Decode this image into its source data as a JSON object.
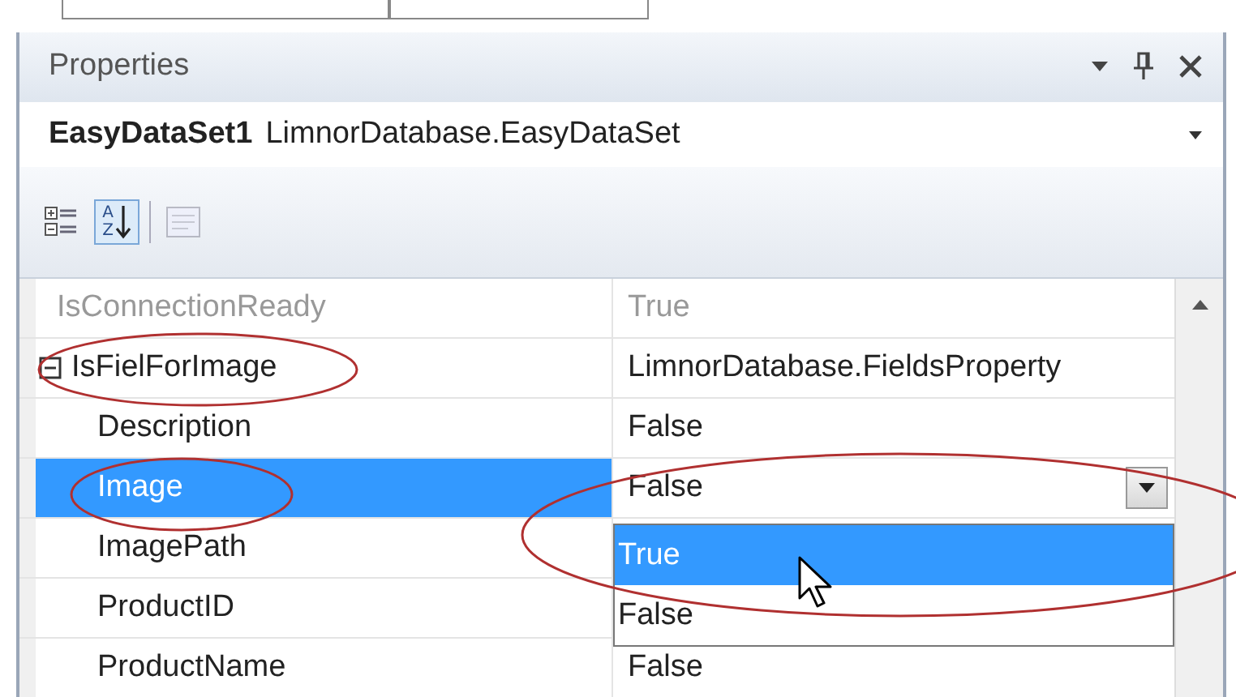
{
  "panel": {
    "title": "Properties",
    "object": {
      "name": "EasyDataSet1",
      "type": "LimnorDatabase.EasyDataSet"
    },
    "toolbar": [
      {
        "kind": "categorized",
        "selected": false,
        "disabled": false
      },
      {
        "kind": "alphabetical",
        "selected": true,
        "disabled": false,
        "letters": [
          "A",
          "Z"
        ]
      },
      {
        "kind": "pages",
        "selected": false,
        "disabled": true
      }
    ],
    "properties": [
      {
        "name": "IsConnectionReady",
        "value": "True",
        "disabled": true,
        "selected": false
      },
      {
        "name": "IsFielForImage",
        "value": "LimnorDatabase.FieldsProperty",
        "disabled": false,
        "selected": false,
        "expanded": true,
        "children": [
          {
            "name": "Description",
            "value": "False",
            "disabled": false,
            "selected": false
          },
          {
            "name": "Image",
            "value": "False",
            "disabled": false,
            "selected": true,
            "dropdown": {
              "options": [
                {
                  "label": "True",
                  "selected": true
                },
                {
                  "label": "False",
                  "selected": false
                }
              ]
            }
          },
          {
            "name": "ImagePath",
            "disabled": false,
            "selected": false
          },
          {
            "name": "ProductID",
            "disabled": false,
            "selected": false
          },
          {
            "name": "ProductName",
            "value": "False",
            "disabled": false,
            "selected": false
          }
        ]
      }
    ]
  }
}
